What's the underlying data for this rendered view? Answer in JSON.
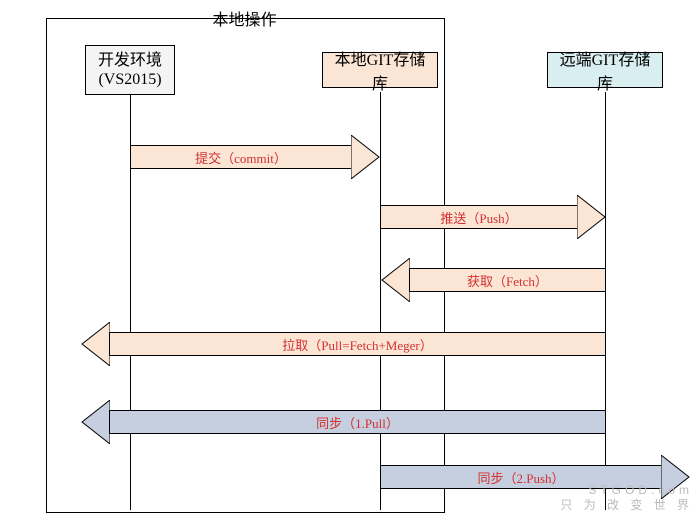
{
  "diagram": {
    "group_title": "本地操作",
    "actors": {
      "dev": {
        "label_l1": "开发环境",
        "label_l2": "(VS2015)"
      },
      "local": {
        "label": "本地GIT存储库"
      },
      "remote": {
        "label": "远端GIT存储库"
      }
    },
    "messages": {
      "commit": "提交（commit）",
      "push": "推送（Push）",
      "fetch": "获取（Fetch）",
      "pull": "拉取（Pull=Fetch+Meger）",
      "sync_pull": "同步（1.Pull）",
      "sync_push": "同步（2.Push）"
    }
  },
  "watermark": {
    "l1": "STGOD.com",
    "l2": "只 为 改 变 世 界"
  }
}
